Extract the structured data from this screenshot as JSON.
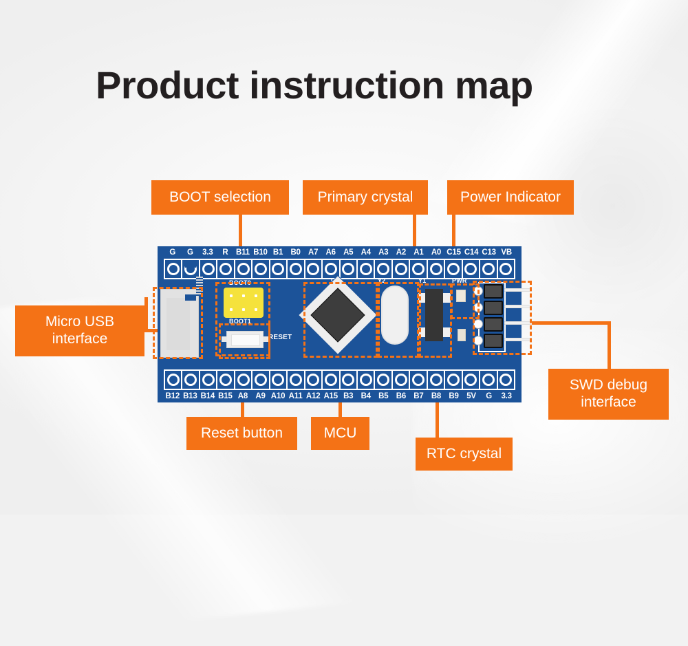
{
  "page": {
    "title": "Product instruction map",
    "background_color": "#f2f2f2",
    "accent_color": "#f47216",
    "board_color": "#1c5399"
  },
  "callouts": [
    {
      "id": "boot-selection",
      "label": "BOOT selection"
    },
    {
      "id": "primary-crystal",
      "label": "Primary crystal"
    },
    {
      "id": "power-indicator",
      "label": "Power Indicator"
    },
    {
      "id": "micro-usb",
      "label": "Micro USB\ninterface",
      "line1": "Micro USB",
      "line2": "interface"
    },
    {
      "id": "reset-button",
      "label": "Reset button"
    },
    {
      "id": "mcu",
      "label": "MCU"
    },
    {
      "id": "rtc-crystal",
      "label": "RTC crystal"
    },
    {
      "id": "swd-debug",
      "label": "SWD debug\ninterface",
      "line1": "SWD debug",
      "line2": "interface"
    }
  ],
  "board": {
    "pins_top": [
      "G",
      "G",
      "3.3",
      "R",
      "B11",
      "B10",
      "B1",
      "B0",
      "A7",
      "A6",
      "A5",
      "A4",
      "A3",
      "A2",
      "A1",
      "A0",
      "C15",
      "C14",
      "C13",
      "VB"
    ],
    "pins_bottom": [
      "B12",
      "B13",
      "B14",
      "B15",
      "A8",
      "A9",
      "A10",
      "A11",
      "A12",
      "A15",
      "B3",
      "B4",
      "B5",
      "B6",
      "B7",
      "B8",
      "B9",
      "5V",
      "G",
      "3.3"
    ],
    "silkscreen": {
      "boot0": "BOOT0",
      "boot1": "BOOT1",
      "reset": "RESET",
      "mcu_ref": "U1",
      "primary_crystal_ref": "Y2",
      "rtc_crystal_ref": "Y1",
      "power_led_ref": "PWR"
    }
  }
}
